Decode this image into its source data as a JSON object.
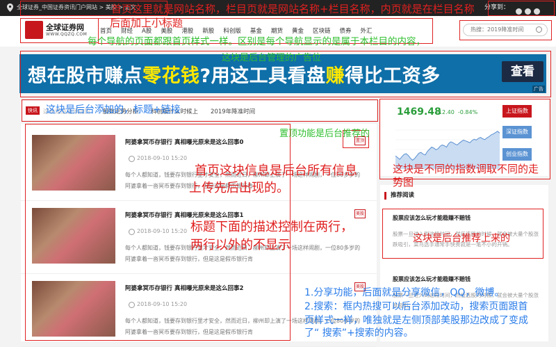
{
  "topbar": {
    "breadcrumb": "全球证券_中国证券资讯门户网站 > 美股 > 正文",
    "share_label": "分享到：",
    "share_icons": [
      "wechat-icon",
      "qq-icon",
      "weibo-icon"
    ]
  },
  "header": {
    "logo_cn": "全球证券网",
    "logo_url": "WWW.QQZQ.COM",
    "nav": [
      "首页",
      "财经",
      "A股",
      "美股",
      "港股",
      "新股",
      "科创版",
      "基金",
      "期货",
      "黄金",
      "区块链",
      "债券",
      "外汇"
    ],
    "search_placeholder": "热搜：2019降准时间"
  },
  "banner": {
    "text_before": "想在股市赚点",
    "text_highlight1": "零花钱",
    "text_mid": "?用这工具看盘",
    "text_highlight2": "赚",
    "text_after": "得比工资多",
    "button": "查看",
    "ad_tag": "广告"
  },
  "ticker": {
    "tag": "快讯",
    "items": [
      "这块是后台添加的",
      "股数走势分析",
      "科创版什么时候上",
      "2019年降准时间"
    ]
  },
  "articles": [
    {
      "title": "阿婆拿冥币存银行 真相曝光原来是这么回事0",
      "badge": "置顶",
      "date": "2018-09-10 15:20",
      "desc": "每个人都知道，钱要存到银行里才安全，然而近日，柳州却上演了一场这样闹剧，一位80多岁的阿婆拿着一沓冥币要存到银行，但是这是假币银行肯"
    },
    {
      "title": "阿婆拿冥币存银行 真相曝光原来是这么回事1",
      "badge": "美股",
      "date": "2018-09-10 15:20",
      "desc": "每个人都知道，钱要存到银行里才安全，然而近日，柳州却上演了一场这样闹剧，一位80多岁的阿婆拿着一沓冥币要存到银行，但是这是假币银行肯"
    },
    {
      "title": "阿婆拿冥币存银行 真相曝光原来是这么回事2",
      "badge": "美股",
      "date": "2018-09-10 15:20",
      "desc": "每个人都知道，钱要存到银行里才安全，然而近日，柳州却上演了一场这样闹剧，一位80多岁的阿婆拿着一沓冥币要存到银行，但是这是假币银行肯"
    }
  ],
  "stock": {
    "price": "1469.48",
    "change": "-12.40",
    "change_pct": "-0.84%",
    "buttons": [
      "上证指数",
      "深证指数",
      "创业指数"
    ],
    "series": [
      0.3,
      0.26,
      0.22,
      0.28,
      0.33,
      0.35,
      0.31,
      0.25,
      0.2,
      0.24,
      0.3,
      0.36,
      0.38,
      0.34,
      0.32,
      0.4,
      0.45,
      0.5,
      0.48,
      0.44,
      0.46,
      0.52,
      0.55,
      0.53,
      0.5,
      0.58,
      0.62,
      0.6,
      0.57,
      0.55,
      0.59,
      0.63,
      0.66,
      0.64,
      0.62,
      0.6,
      0.65,
      0.68,
      0.66,
      0.7,
      0.72,
      0.69,
      0.67,
      0.71,
      0.74,
      0.78,
      0.8,
      0.83,
      0.86,
      0.82
    ]
  },
  "recommend": {
    "title": "推荐阅读",
    "items": [
      {
        "title": "股票应该怎么玩才能稳赚不赔钱",
        "desc": "股票一旦进入到这段时间，然后选股的时候，就会被大量个股涨跌吸引，菜鸟选手通常手快贵就是一笔不小的开销。"
      },
      {
        "title": "股票应该怎么玩才能稳赚不赔钱",
        "desc": "股票一旦进入到这段时间，然后选股的时候，就会被大量个股涨跌吸引。"
      }
    ]
  },
  "annotations": {
    "a1": "首页这里就是网站名称，栏目页就是网站名称+栏目名称，内页就是在栏目名称",
    "a2": "后面加上小标题",
    "a3": "每个导航的页面都跟首页样式一样。区别是每个导航显示的是属于本栏目的内容，",
    "a4": "这块是后台管理的广告位",
    "a5": "这块是后台添加的，标题+链接",
    "a6": "置顶功能是后台推荐的",
    "a7": "首页这块信息是后台所有信息",
    "a8": "上传先后出现的。",
    "a9": "标题下面的描述控制在两行，",
    "a10": "两行以外的不显示",
    "a11": "这块是不同的指数调取不同的走",
    "a12": "势图",
    "a13": "这块是后台推荐上来的",
    "a14": "1.分享功能，后面就是分享微信，QQ，微博。",
    "a15": "2.搜索：框内热搜可以后台添加改动，搜索页面跟首",
    "a16": "页样式一样，唯独就是左侧顶部美股那边改成了变成",
    "a17": "了“     搜索”+搜索的内容。"
  }
}
